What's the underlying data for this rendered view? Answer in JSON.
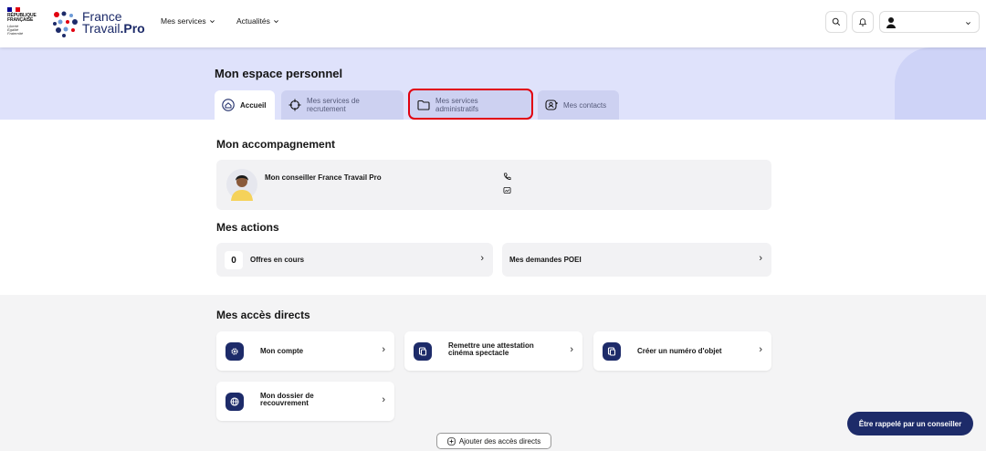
{
  "header": {
    "republique": [
      "RÉPUBLIQUE",
      "FRANÇAISE"
    ],
    "devise": [
      "Liberté",
      "Égalité",
      "Fraternité"
    ],
    "brand_line1": "France",
    "brand_line2": "Travail",
    "brand_suffix": ".Pro",
    "nav": [
      {
        "label": "Mes services"
      },
      {
        "label": "Actualités"
      }
    ]
  },
  "hero": {
    "title": "Mon espace personnel"
  },
  "tabs": [
    {
      "label": "Accueil",
      "icon": "home-icon"
    },
    {
      "label": "Mes services de recrutement",
      "icon": "crosshair-icon"
    },
    {
      "label": "Mes services administratifs",
      "icon": "folder-icon"
    },
    {
      "label": "Mes contacts",
      "icon": "contact-icon"
    }
  ],
  "accompagnement": {
    "heading": "Mon accompagnement",
    "conseiller_label": "Mon conseiller France Travail Pro"
  },
  "actions": {
    "heading": "Mes actions",
    "offres_count": "0",
    "offres_label": "Offres en cours",
    "poei_label": "Mes demandes POEI"
  },
  "acces": {
    "heading": "Mes accès directs",
    "items": [
      {
        "label": "Mon compte",
        "icon": "gear-icon"
      },
      {
        "label": "Remettre une attestation cinéma spectacle",
        "icon": "document-icon"
      },
      {
        "label": "Créer un numéro d'objet",
        "icon": "document-icon"
      },
      {
        "label": "Mon dossier de recouvrement",
        "icon": "globe-icon"
      }
    ],
    "add_label": "Ajouter des accès directs"
  },
  "callback_label": "Être rappelé par un conseiller",
  "colors": {
    "brand_navy": "#1d2b69",
    "hero_bg": "#dfe2fb",
    "highlight_red": "#e1000f"
  }
}
